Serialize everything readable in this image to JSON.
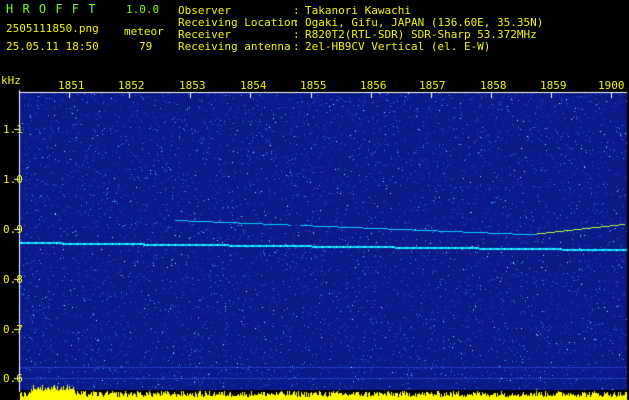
{
  "app": {
    "name": "H R O F F T",
    "version": "1.0.0"
  },
  "file": {
    "name": "2505111850.png",
    "datetime": "25.05.11 18:50"
  },
  "meteor": {
    "label": "meteor",
    "count": "79"
  },
  "info": [
    {
      "key": "Observer",
      "sep": ":",
      "value": "Takanori Kawachi"
    },
    {
      "key": "Receiving Location",
      "sep": ":",
      "value": "Ogaki, Gifu, JAPAN (136.60E, 35.35N)"
    },
    {
      "key": "Receiver",
      "sep": ":",
      "value": "R820T2(RTL-SDR) SDR-Sharp 53.372MHz"
    },
    {
      "key": "Receiving antenna",
      "sep": ":",
      "value": "2el-HB9CV Vertical (el. E-W)"
    }
  ],
  "axis": {
    "y_unit": "kHz",
    "y_ticks": [
      "1.1",
      "1.0",
      "0.9",
      "0.8",
      "0.7",
      "0.6"
    ],
    "x_ticks": [
      "1851",
      "1852",
      "1853",
      "1854",
      "1855",
      "1856",
      "1857",
      "1858",
      "1859",
      "1900"
    ]
  },
  "colors": {
    "text_green": "#7CFC00",
    "text_yellow": "#f2f200",
    "background": "#000000",
    "noise_base": "#0a1a88",
    "signal": "#00e0ff"
  }
}
